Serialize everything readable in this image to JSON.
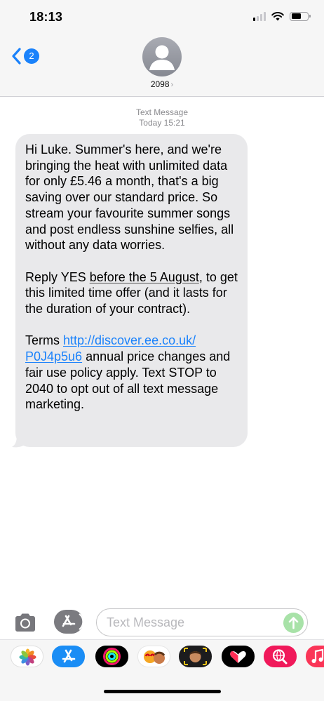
{
  "status_bar": {
    "time": "18:13",
    "icons": [
      "cellular-signal-icon",
      "wifi-icon",
      "battery-icon"
    ],
    "signal_bars_active": 1,
    "signal_bars_total": 4,
    "battery_level": 0.65
  },
  "header": {
    "back_icon": "chevron-left-icon",
    "unread_count": "2",
    "contact_name": "2098",
    "contact_chevron": "›"
  },
  "thread": {
    "label": "Text Message",
    "timestamp": "Today 15:21"
  },
  "message": {
    "para1": "Hi Luke. Summer's here, and we're bringing the heat with unlimited data for only £5.46 a month, that's a big saving over our standard price. So stream your favourite summer songs and post endless sunshine selfies, all without any data worries.",
    "para2_before": "Reply YES ",
    "para2_date": "before the 5 August",
    "para2_after": ", to get this limited time offer (and it lasts for the duration of your contract).",
    "para3_before": "Terms ",
    "para3_link_line1": "http://discover.ee.co.uk/",
    "para3_link_line2": "P0J4p5u6",
    "para3_after": " annual price changes and fair use policy apply. Text STOP to 2040 to opt out of all text message marketing."
  },
  "compose": {
    "placeholder": "Text Message",
    "value": ""
  },
  "app_drawer": {
    "apps": [
      "photos",
      "app-store",
      "activity",
      "memoji-stickers",
      "memoji",
      "digital-touch",
      "web-search",
      "music"
    ]
  },
  "colors": {
    "accent_blue": "#1a82fb",
    "bubble_gray": "#e9e9eb",
    "send_green": "#a8e2a8"
  }
}
